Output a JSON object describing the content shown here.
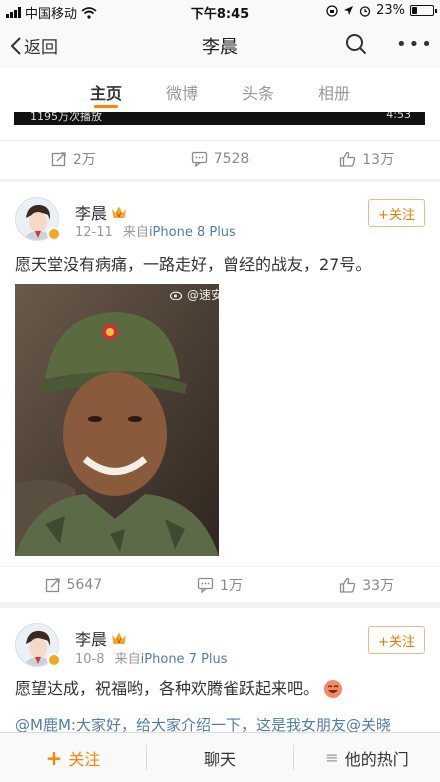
{
  "status_bar": {
    "carrier": "中国移动",
    "time": "下午8:45",
    "battery": "23%",
    "battery_level": 0.23
  },
  "nav": {
    "back_label": "返回",
    "title": "李晨"
  },
  "tabs": [
    {
      "label": "主页",
      "active": true
    },
    {
      "label": "微博",
      "active": false
    },
    {
      "label": "头条",
      "active": false
    },
    {
      "label": "相册",
      "active": false
    }
  ],
  "card1": {
    "video_views": "1195万次播放",
    "video_duration": "4:53",
    "actions": {
      "repost": "2万",
      "comment": "7528",
      "like": "13万"
    }
  },
  "post1": {
    "author": "李晨",
    "time": "12-11",
    "source_prefix": "来自",
    "source": "iPhone 8 Plus",
    "follow_label": "+关注",
    "text": "愿天堂没有病痛，一路走好，曾经的战友，27号。",
    "watermark": "@速安安县关注",
    "actions": {
      "repost": "5647",
      "comment": "1万",
      "like": "33万"
    }
  },
  "post2": {
    "author": "李晨",
    "time": "10-8",
    "source_prefix": "来自",
    "source": "iPhone 7 Plus",
    "follow_label": "+关注",
    "text": "愿望达成，祝福哟，各种欢腾雀跃起来吧。",
    "mention_line": "@M鹿M:大家好，给大家介绍一下，这是我女朋友@关晓"
  },
  "bottom_bar": {
    "follow": "关注",
    "chat": "聊天",
    "hot": "他的热门"
  },
  "colors": {
    "accent": "#ff8200",
    "link": "#507daf",
    "verified": "#f5a623"
  }
}
